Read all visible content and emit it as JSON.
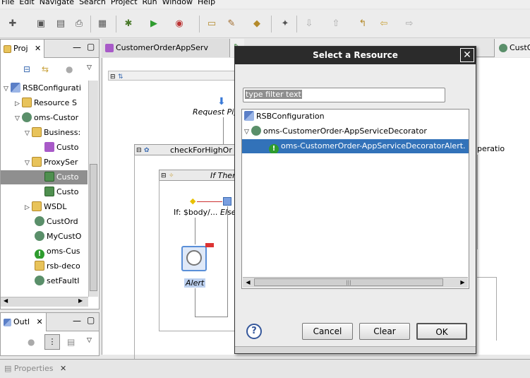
{
  "menu": [
    "File",
    "Edit",
    "Navigate",
    "Search",
    "Project",
    "Run",
    "Window",
    "Help"
  ],
  "project_panel": {
    "tab_label": "Proj",
    "tree": [
      {
        "label": "RSBConfigurati",
        "icon": "project-icon",
        "twisty": "▽"
      },
      {
        "label": "Resource S",
        "icon": "folder-icon",
        "twisty": "▷"
      },
      {
        "label": "oms-Custor",
        "icon": "service-icon",
        "twisty": "▽"
      },
      {
        "label": "Business:",
        "icon": "folder-icon",
        "twisty": "▽"
      },
      {
        "label": "Custo",
        "icon": "business-service-icon",
        "twisty": ""
      },
      {
        "label": "ProxySer",
        "icon": "folder-icon",
        "twisty": "▽"
      },
      {
        "label": "Custo",
        "icon": "proxy-service-icon",
        "twisty": ""
      },
      {
        "label": "Custo",
        "icon": "proxy-service-icon",
        "twisty": ""
      },
      {
        "label": "WSDL",
        "icon": "folder-icon",
        "twisty": "▷"
      },
      {
        "label": "CustOrd",
        "icon": "gear-icon",
        "twisty": ""
      },
      {
        "label": "MyCustO",
        "icon": "gear-icon",
        "twisty": ""
      },
      {
        "label": "oms-Cus",
        "icon": "alert-icon",
        "twisty": ""
      },
      {
        "label": "rsb-deco",
        "icon": "file-icon",
        "twisty": ""
      },
      {
        "label": "setFaultI",
        "icon": "gear-icon",
        "twisty": ""
      }
    ]
  },
  "outline_panel": {
    "tab_label": "Outl"
  },
  "properties_tab": "Properties",
  "editor": {
    "tabs": [
      {
        "label": "CustomerOrderAppServ"
      },
      {
        "label": "CustO"
      }
    ],
    "canvas": {
      "request_pipeline": "Request Pip",
      "stage_label": "checkForHighOr",
      "if_then": "If Then",
      "if_condition": "If: $body/...",
      "else": "Else",
      "alert": "Alert",
      "operation": "peratio"
    }
  },
  "dialog": {
    "title": "Select a Resource",
    "filter_placeholder": "type filter text",
    "tree": [
      {
        "label": "RSBConfiguration",
        "twisty": ""
      },
      {
        "label": "oms-CustomerOrder-AppServiceDecorator",
        "twisty": "▽"
      },
      {
        "label": "oms-CustomerOrder-AppServiceDecoratorAlert.",
        "twisty": "",
        "selected": true
      }
    ],
    "buttons": {
      "help": "?",
      "cancel": "Cancel",
      "clear": "Clear",
      "ok": "OK"
    }
  },
  "colors": {
    "selection": "#3272b9",
    "dialog_title_bg": "#2b2b2b"
  }
}
